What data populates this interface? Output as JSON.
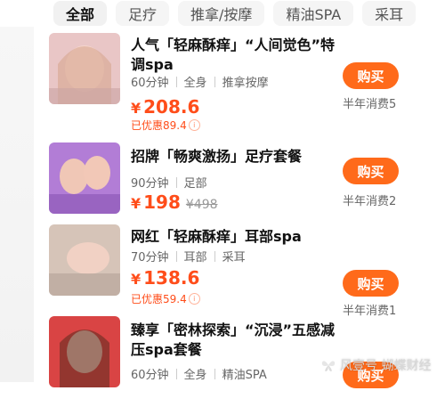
{
  "colors": {
    "accent": "#ff6a1a",
    "price": "#ff4d1a"
  },
  "tabs": [
    {
      "label": "全部",
      "active": true
    },
    {
      "label": "足疗",
      "active": false
    },
    {
      "label": "推拿/按摩",
      "active": false
    },
    {
      "label": "精油SPA",
      "active": false
    },
    {
      "label": "采耳",
      "active": false
    }
  ],
  "items": [
    {
      "title": "人气「轻麻酥痒」“人间觉色”特调spa",
      "meta": [
        "60分钟",
        "全身",
        "推拿按摩"
      ],
      "price": "208.6",
      "orig_price": "",
      "discount": "已优惠89.4",
      "buy_label": "购买",
      "sales": "半年消费5"
    },
    {
      "title": "招牌「畅爽激扬」足疗套餐",
      "meta": [
        "90分钟",
        "足部"
      ],
      "price": "198",
      "orig_price": "¥498",
      "discount": "",
      "buy_label": "购买",
      "sales": "半年消费2"
    },
    {
      "title": "网红「轻麻酥痒」耳部spa",
      "meta": [
        "70分钟",
        "耳部",
        "采耳"
      ],
      "price": "138.6",
      "orig_price": "",
      "discount": "已优惠59.4",
      "buy_label": "购买",
      "sales": "半年消费1"
    },
    {
      "title": "臻享「密林探索」“沉浸”五感减压spa套餐",
      "meta": [
        "60分钟",
        "全身",
        "精油SPA"
      ],
      "price": "",
      "orig_price": "",
      "discount": "",
      "buy_label": "购买",
      "sales": ""
    }
  ],
  "currency": "¥",
  "watermark": "风壹号 蝴蝶财经"
}
